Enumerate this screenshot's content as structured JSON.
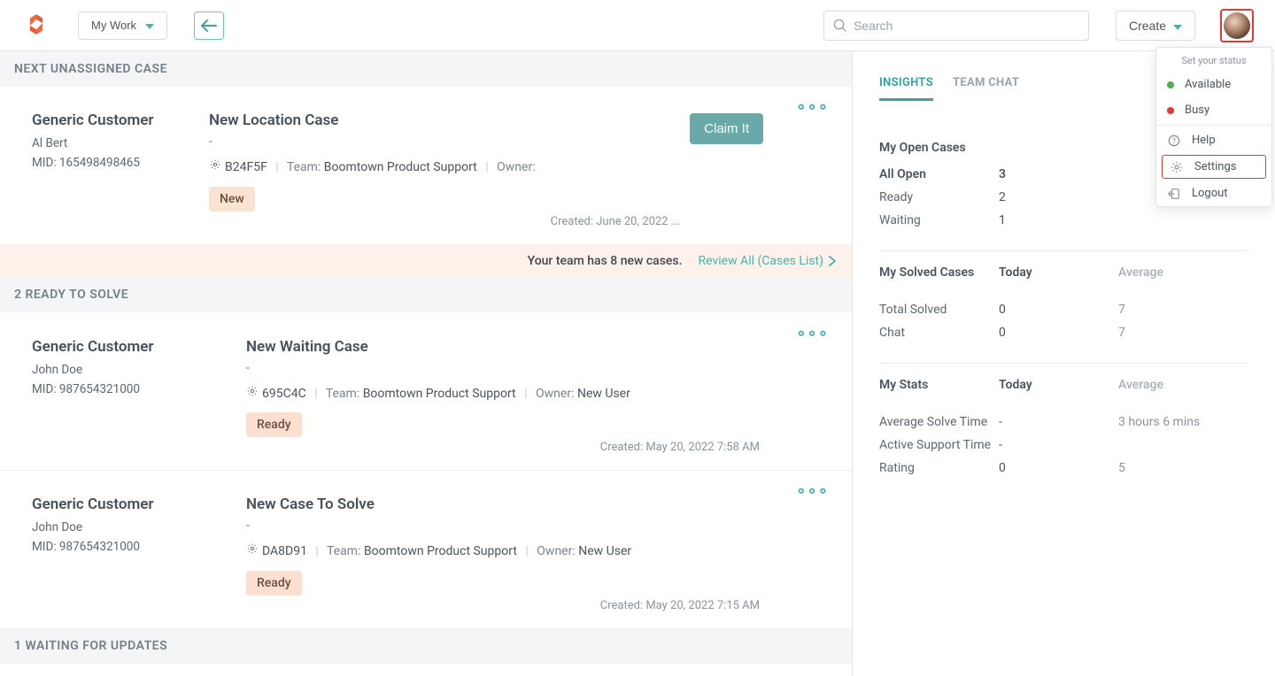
{
  "header": {
    "my_work_label": "My Work",
    "search_placeholder": "Search",
    "create_label": "Create"
  },
  "user_menu": {
    "heading": "Set your status",
    "available": "Available",
    "busy": "Busy",
    "help": "Help",
    "settings": "Settings",
    "logout": "Logout"
  },
  "feed": {
    "section_next": "NEXT UNASSIGNED CASE",
    "section_ready": "2 READY TO SOLVE",
    "section_waiting": "1 WAITING FOR UPDATES",
    "notice_text": "Your team has 8 new cases.",
    "review_link": "Review All (Cases List)",
    "claim_label": "Claim It",
    "cases": {
      "c1": {
        "customer": "Generic Customer",
        "contact": "Al Bert",
        "mid": "MID: 165498498465",
        "title": "New Location Case",
        "dash": "-",
        "ref": "B24F5F",
        "team_label": "Team:",
        "team": "Boomtown Product Support",
        "owner_label": "Owner:",
        "owner": "",
        "badge": "New",
        "created": "Created: June 20, 2022 ..."
      },
      "c2": {
        "customer": "Generic Customer",
        "contact": "John Doe",
        "mid": "MID: 987654321000",
        "title": "New Waiting Case",
        "dash": "-",
        "ref": "695C4C",
        "team_label": "Team:",
        "team": "Boomtown Product Support",
        "owner_label": "Owner:",
        "owner": "New User",
        "badge": "Ready",
        "created": "Created: May 20, 2022 7:58 AM"
      },
      "c3": {
        "customer": "Generic Customer",
        "contact": "John Doe",
        "mid": "MID: 987654321000",
        "title": "New Case To Solve",
        "dash": "-",
        "ref": "DA8D91",
        "team_label": "Team:",
        "team": "Boomtown Product Support",
        "owner_label": "Owner:",
        "owner": "New User",
        "badge": "Ready",
        "created": "Created: May 20, 2022 7:15 AM"
      }
    }
  },
  "sidebar": {
    "tab_insights": "INSIGHTS",
    "tab_chat": "TEAM CHAT",
    "open": {
      "heading": "My Open Cases",
      "all_label": "All Open",
      "all_val": "3",
      "ready_label": "Ready",
      "ready_val": "2",
      "waiting_label": "Waiting",
      "waiting_val": "1"
    },
    "solved": {
      "heading": "My Solved Cases",
      "today_head": "Today",
      "avg_head": "Average",
      "total_label": "Total Solved",
      "total_today": "0",
      "total_avg": "7",
      "chat_label": "Chat",
      "chat_today": "0",
      "chat_avg": "7"
    },
    "stats": {
      "heading": "My Stats",
      "today_head": "Today",
      "avg_head": "Average",
      "ast_label": "Average Solve Time",
      "ast_today": "-",
      "ast_avg": "3 hours 6 mins",
      "sup_label": "Active Support Time",
      "sup_today": "-",
      "sup_avg": "",
      "rating_label": "Rating",
      "rating_today": "0",
      "rating_avg": "5"
    }
  }
}
